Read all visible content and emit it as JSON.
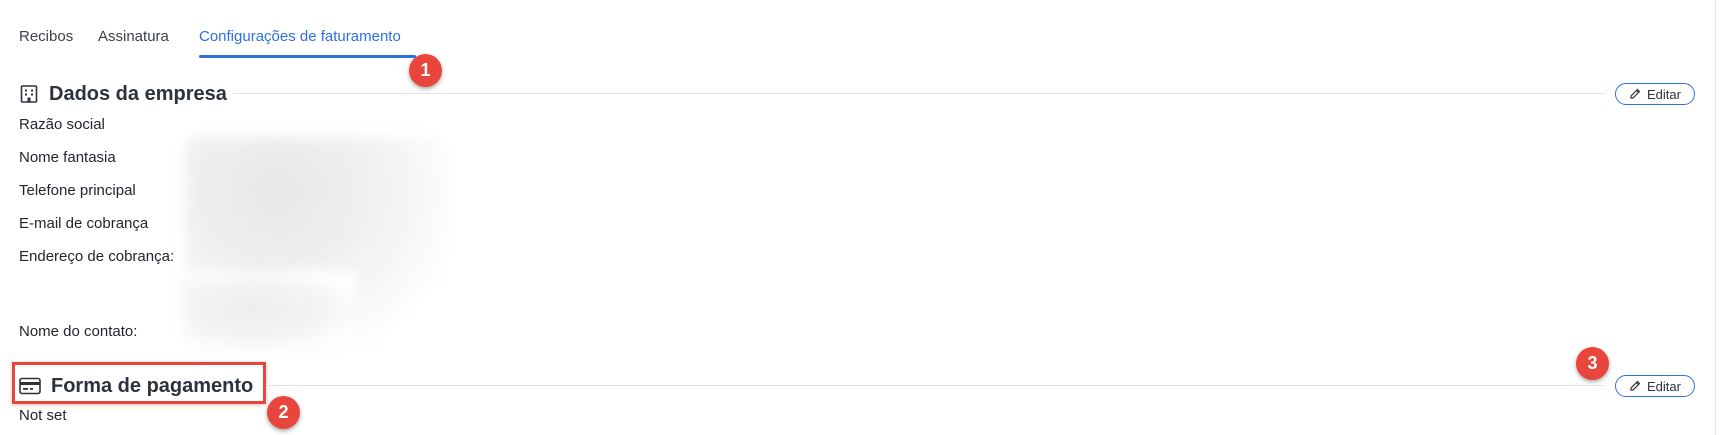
{
  "tabs": [
    {
      "label": "Recibos"
    },
    {
      "label": "Assinatura"
    },
    {
      "label": "Configurações de faturamento",
      "active": true
    }
  ],
  "company_section": {
    "title": "Dados da empresa",
    "icon": "building-icon",
    "edit_label": "Editar",
    "fields": [
      {
        "label": "Razão social"
      },
      {
        "label": "Nome fantasia"
      },
      {
        "label": "Telefone principal"
      },
      {
        "label": "E-mail de cobrança"
      },
      {
        "label": "Endereço de cobrança:"
      },
      {
        "label": "Nome do contato:"
      }
    ]
  },
  "payment_section": {
    "title": "Forma de pagamento",
    "icon": "credit-card-icon",
    "edit_label": "Editar",
    "value": "Not set"
  },
  "annotations": [
    "1",
    "2",
    "3"
  ],
  "colors": {
    "accent": "#2f6fe0",
    "annotation": "#e8453c"
  }
}
